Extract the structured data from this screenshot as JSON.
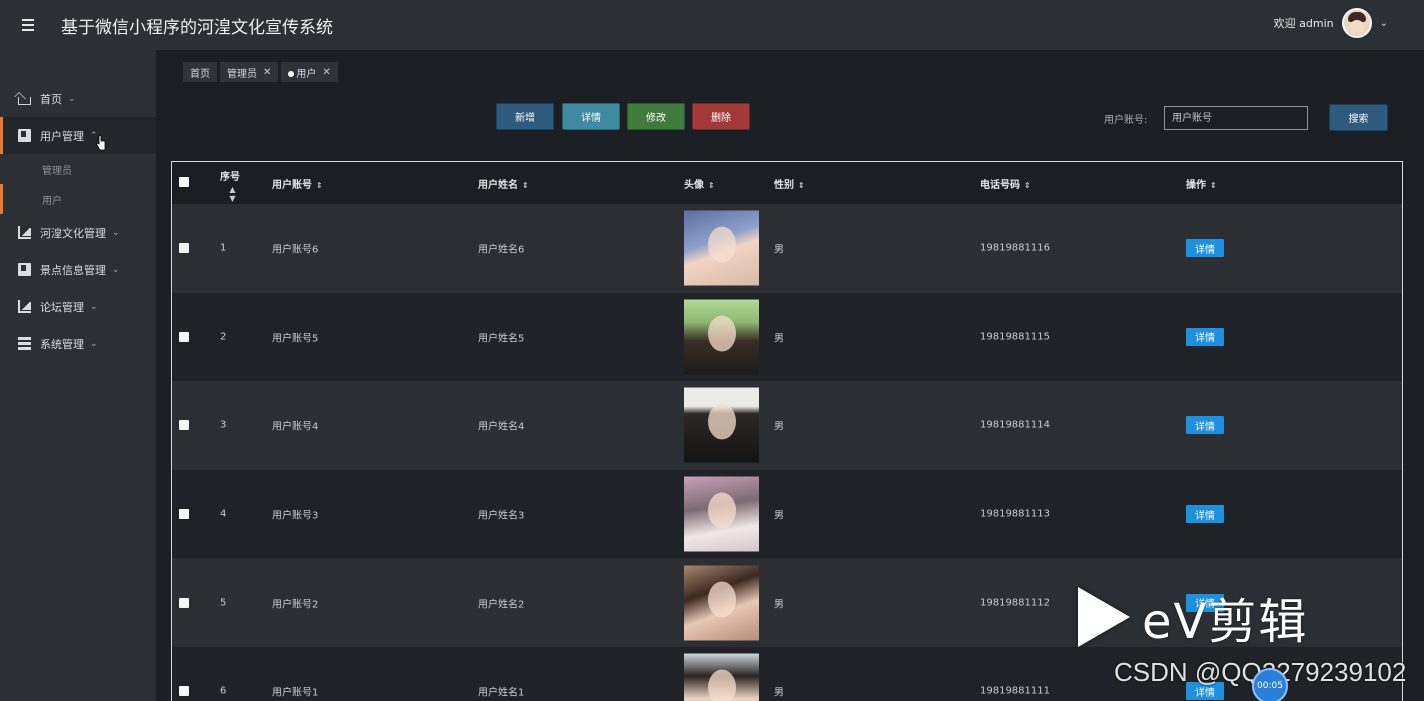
{
  "header": {
    "title": "基于微信小程序的河湟文化宣传系统",
    "welcome": "欢迎 admin"
  },
  "sidebar": {
    "items": [
      {
        "label": "首页",
        "icon": "home-icon",
        "arrow": "⌄"
      },
      {
        "label": "用户管理",
        "icon": "book-icon",
        "arrow": "⌃"
      },
      {
        "label": "河湟文化管理",
        "icon": "chart-icon",
        "arrow": "⌄"
      },
      {
        "label": "景点信息管理",
        "icon": "book-icon",
        "arrow": "⌄"
      },
      {
        "label": "论坛管理",
        "icon": "chart-icon",
        "arrow": "⌄"
      },
      {
        "label": "系统管理",
        "icon": "list-icon",
        "arrow": "⌄"
      }
    ],
    "subitems": [
      "管理员",
      "用户"
    ]
  },
  "tabs": [
    {
      "label": "首页"
    },
    {
      "label": "管理员"
    },
    {
      "label": "用户"
    }
  ],
  "toolbar": {
    "add": "新增",
    "detail": "详情",
    "edit": "修改",
    "delete": "删除",
    "search_label": "用户账号:",
    "search_placeholder": "用户账号",
    "search": "搜索"
  },
  "table": {
    "headers": {
      "index": "序号",
      "account": "用户账号",
      "name": "用户姓名",
      "avatar": "头像",
      "gender": "性别",
      "phone": "电话号码",
      "action": "操作"
    },
    "rows": [
      {
        "index": "1",
        "account": "用户账号6",
        "name": "用户姓名6",
        "gender": "男",
        "phone": "19819881116",
        "action": "详情"
      },
      {
        "index": "2",
        "account": "用户账号5",
        "name": "用户姓名5",
        "gender": "男",
        "phone": "19819881115",
        "action": "详情"
      },
      {
        "index": "3",
        "account": "用户账号4",
        "name": "用户姓名4",
        "gender": "男",
        "phone": "19819881114",
        "action": "详情"
      },
      {
        "index": "4",
        "account": "用户账号3",
        "name": "用户姓名3",
        "gender": "男",
        "phone": "19819881113",
        "action": "详情"
      },
      {
        "index": "5",
        "account": "用户账号2",
        "name": "用户姓名2",
        "gender": "男",
        "phone": "19819881112",
        "action": "详情"
      },
      {
        "index": "6",
        "account": "用户账号1",
        "name": "用户姓名1",
        "gender": "男",
        "phone": "19819881111",
        "action": "详情"
      }
    ]
  },
  "overlay": {
    "ev_text": "eV剪辑",
    "csdn": "CSDN @QQ2279239102",
    "timer": "00:05"
  },
  "colors": {
    "accent": "#e8792e",
    "primary": "#2e5a7e",
    "info": "#3f8aa0",
    "success": "#3f7b3d",
    "danger": "#a3383a",
    "detail_button": "#1e90e0"
  }
}
